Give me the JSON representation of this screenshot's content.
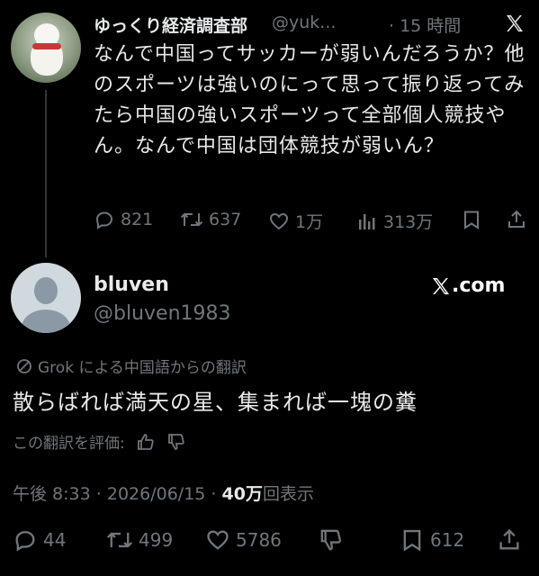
{
  "post1": {
    "display_name": "ゆっくり経済調査部",
    "handle": "@yuk...",
    "separator": "·",
    "time": "15 時間",
    "text": "なんで中国ってサッカーが弱いんだろうか？他のスポーツは強いのにって思って振り返ってみたら中国の強いスポーツって全部個人競技やん。なんで中国は団体競技が弱いん？",
    "replies": "821",
    "reposts": "637",
    "likes": "1万",
    "views": "313万"
  },
  "post2": {
    "display_name": "bluven",
    "handle": "@bluven1983",
    "xcom_label": ".com",
    "translation_note": "Grok による中国語からの翻訳",
    "text": "散らばれば満天の星、集まれば一塊の糞",
    "rate_label": "この翻訳を評価:",
    "meta": {
      "time": "午後 8:33",
      "dot": "·",
      "date": "2026/06/15",
      "views_count": "40万",
      "views_suffix": "回表示"
    },
    "replies": "44",
    "reposts": "499",
    "likes": "5786",
    "bookmarks": "612"
  }
}
